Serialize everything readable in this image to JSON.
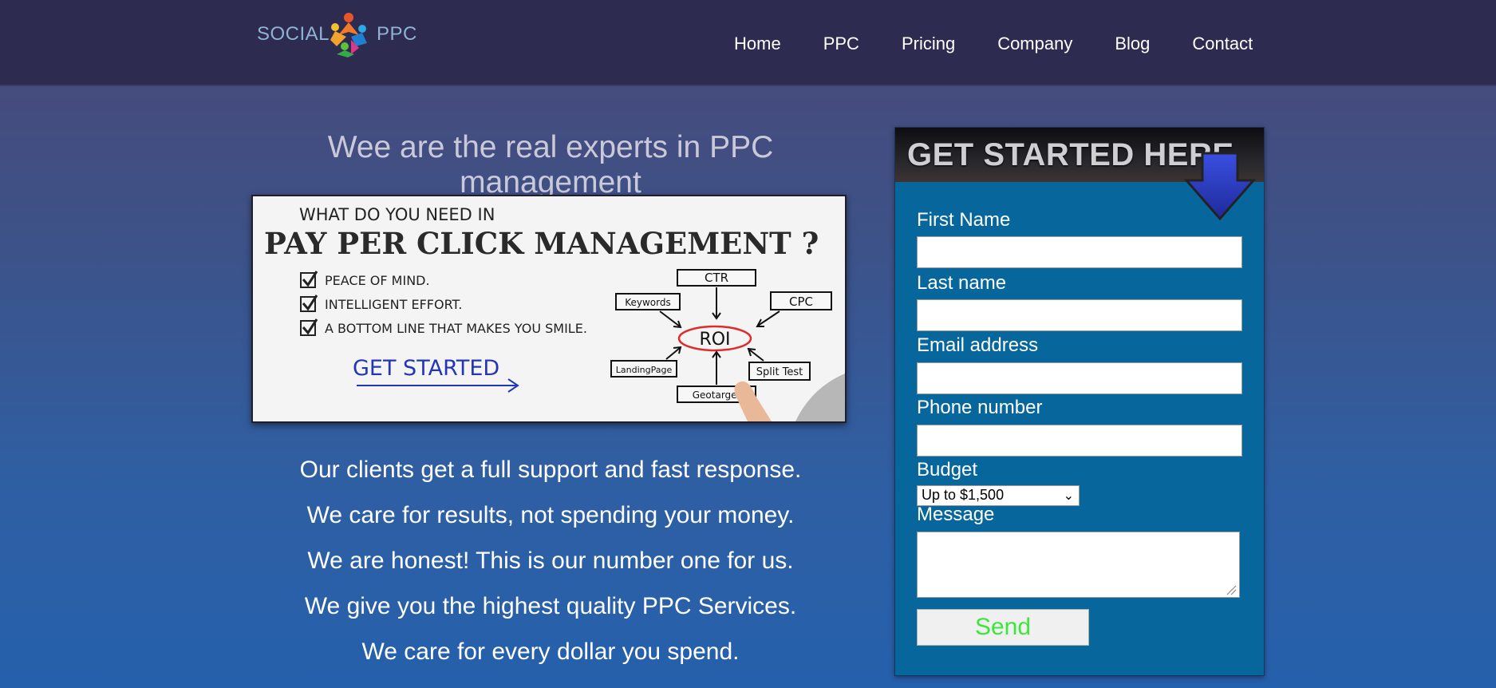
{
  "header": {
    "logo": {
      "left_text": "SOCIAL",
      "right_text": "PPC"
    },
    "nav": [
      "Home",
      "PPC",
      "Pricing",
      "Company",
      "Blog",
      "Contact"
    ]
  },
  "main": {
    "headline": "Wee are the real experts in PPC management",
    "banner": {
      "line1": "WHAT DO YOU NEED IN",
      "line2": "PAY PER CLICK MANAGEMENT ?",
      "checklist": [
        "PEACE OF MIND.",
        "INTELLIGENT EFFORT.",
        "A BOTTOM LINE THAT MAKES YOU SMILE."
      ],
      "cta": "GET STARTED",
      "diagram": {
        "center": "ROI",
        "nodes": [
          "CTR",
          "Keywords",
          "CPC",
          "LandingPage",
          "Split Test",
          "Geotarget"
        ]
      }
    },
    "features": [
      "Our clients get a full support and fast response.",
      "We care for results, not spending your money.",
      "We are honest! This is our number one for us.",
      "We give you the highest quality PPC Services.",
      "We care for every dollar you spend."
    ]
  },
  "form": {
    "title": "GET STARTED HERE",
    "first_name_label": "First Name",
    "last_name_label": "Last name",
    "email_label": "Email address",
    "phone_label": "Phone number",
    "budget_label": "Budget",
    "budget_value": "Up to $1,500",
    "message_label": "Message",
    "send_label": "Send",
    "accent_color": "#07679c",
    "send_text_color": "#3ce63a"
  }
}
